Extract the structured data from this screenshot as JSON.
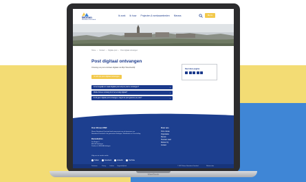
{
  "site": {
    "logo_name": "Wonen",
    "logo_sub": "Noordwest Friesland",
    "nav": [
      "Ik zoek",
      "Ik huur",
      "Projecten & werkzaamheden",
      "Nieuws"
    ],
    "menu_label": "Menu"
  },
  "breadcrumb": [
    "Home",
    "Contact",
    "Digitale post",
    "Post digitaal ontvangen"
  ],
  "main": {
    "title": "Post digitaal ontvangen",
    "intro": "Ontvang uw post voortaan digitaal via Mijn Woonbedrijf.",
    "cta_label": "Ik wil mijn post digitaal ontvangen",
    "faq": [
      "Is het mogelijk om naast digitale post ook per post te ontvangen?",
      "Welke brieven ontvang ik in het vervolg digitaal?",
      "Ik wil geen digitale post ontvangen, mag ik de post gewoon per post?"
    ]
  },
  "sidebar": {
    "title": "Deel deze pagina"
  },
  "footer": {
    "about_title": "Over Wonen NWF",
    "about_lines": [
      "Wonen Noordwest Friesland biedt woonruimte aan de bewoners van",
      "Noordwest Friesland in de gemeenten Harlingen, Waadhoeke en Terschelling."
    ],
    "visit_title": "Bezoekadres",
    "visit_lines": [
      "De Steiger 2",
      "8861 AT Harlingen",
      "Postbus 4, 8860 AA Harlingen"
    ],
    "links_title": "Over ons",
    "links": [
      "Onze missie",
      "Organisatie",
      "Nieuws",
      "Huurders raad",
      "Werken bij",
      "Contact"
    ],
    "social_title": "Volg ons via sociale media",
    "social": [
      "Twitter",
      "Facebook",
      "LinkedIn",
      "YouTube"
    ],
    "bottom": [
      "Disclaimer",
      "Privacy",
      "Cookies",
      "Toegankelijkheid"
    ],
    "copyright": "© 2022 Wonen Noordwest Friesland",
    "credit": "Website door"
  },
  "device": {
    "label": "MacBook"
  },
  "colors": {
    "brand_blue": "#1b3a8c",
    "accent_yellow": "#f2c94c",
    "backdrop_yellow": "#f3dc74",
    "backdrop_blue": "#3f86d6"
  }
}
